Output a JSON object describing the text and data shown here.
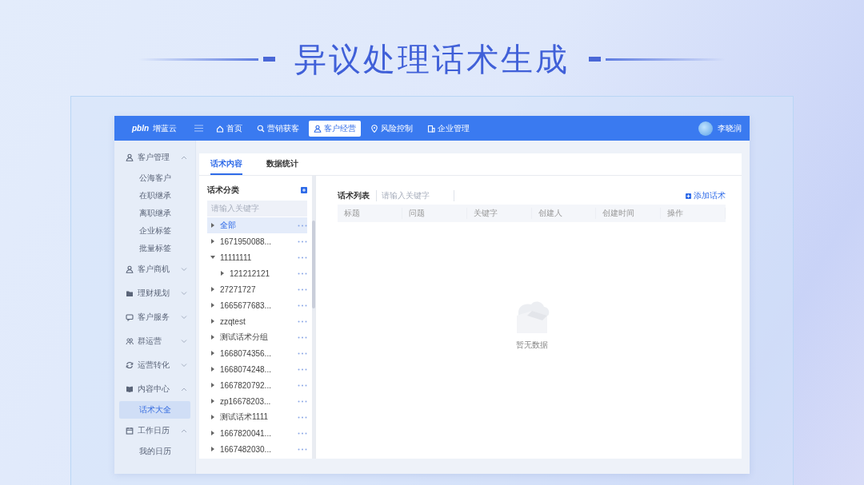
{
  "title": "异议处理话术生成",
  "app": {
    "logo_text": "pbln",
    "brand": "增蓝云",
    "user": "李晓润",
    "nav": [
      {
        "label": "首页",
        "selected": false
      },
      {
        "label": "营销获客",
        "selected": false
      },
      {
        "label": "客户经营",
        "selected": true
      },
      {
        "label": "风险控制",
        "selected": false
      },
      {
        "label": "企业管理",
        "selected": false
      }
    ]
  },
  "sidebar": [
    {
      "label": "客户管理",
      "expanded": true,
      "children": [
        {
          "label": "公海客户",
          "selected": false
        },
        {
          "label": "在职继承",
          "selected": false
        },
        {
          "label": "离职继承",
          "selected": false
        },
        {
          "label": "企业标签",
          "selected": false
        },
        {
          "label": "批量标签",
          "selected": false
        }
      ]
    },
    {
      "label": "客户商机",
      "expanded": false
    },
    {
      "label": "理财规划",
      "expanded": false
    },
    {
      "label": "客户服务",
      "expanded": false
    },
    {
      "label": "群运营",
      "expanded": false
    },
    {
      "label": "运营转化",
      "expanded": false
    },
    {
      "label": "内容中心",
      "expanded": true,
      "children": [
        {
          "label": "话术大全",
          "selected": true
        }
      ]
    },
    {
      "label": "工作日历",
      "expanded": true,
      "children": [
        {
          "label": "我的日历",
          "selected": false
        }
      ]
    }
  ],
  "tabs": [
    {
      "label": "话术内容",
      "selected": true
    },
    {
      "label": "数据统计",
      "selected": false
    }
  ],
  "category_panel": {
    "title": "话术分类",
    "search_placeholder": "请输入关键字",
    "tree": [
      {
        "label": "全部",
        "selected": true,
        "expanded": false
      },
      {
        "label": "1671950088...",
        "selected": false,
        "expanded": false
      },
      {
        "label": "11111111",
        "selected": false,
        "expanded": true,
        "children": [
          {
            "label": "121212121",
            "selected": false,
            "expanded": false
          }
        ]
      },
      {
        "label": "27271727",
        "selected": false,
        "expanded": false
      },
      {
        "label": "1665677683...",
        "selected": false,
        "expanded": false
      },
      {
        "label": "zzqtest",
        "selected": false,
        "expanded": false
      },
      {
        "label": "测试话术分组",
        "selected": false,
        "expanded": false
      },
      {
        "label": "1668074356...",
        "selected": false,
        "expanded": false
      },
      {
        "label": "1668074248...",
        "selected": false,
        "expanded": false
      },
      {
        "label": "1667820792...",
        "selected": false,
        "expanded": false
      },
      {
        "label": "zp16678203...",
        "selected": false,
        "expanded": false
      },
      {
        "label": "测试话术1111",
        "selected": false,
        "expanded": false
      },
      {
        "label": "1667820041...",
        "selected": false,
        "expanded": false
      },
      {
        "label": "1667482030...",
        "selected": false,
        "expanded": false
      }
    ]
  },
  "list_panel": {
    "title": "话术列表",
    "search_placeholder": "请输入关键字",
    "add_button": "添加话术",
    "columns": [
      "标题",
      "问题",
      "关键字",
      "创建人",
      "创建时间",
      "操作"
    ],
    "empty_text": "暂无数据"
  }
}
